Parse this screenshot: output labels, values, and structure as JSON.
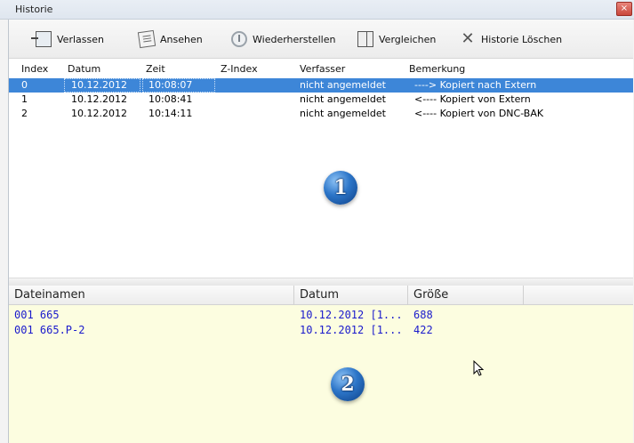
{
  "window": {
    "title": "Historie",
    "close_symbol": "×"
  },
  "toolbar": {
    "buttons": [
      {
        "label": "Verlassen",
        "icon": "exit-door-icon"
      },
      {
        "label": "Ansehen",
        "icon": "view-document-icon"
      },
      {
        "label": "Wiederherstellen",
        "icon": "restore-icon"
      },
      {
        "label": "Vergleichen",
        "icon": "compare-icon"
      },
      {
        "label": "Historie Löschen",
        "icon": "delete-x-icon"
      }
    ]
  },
  "history_table": {
    "columns": [
      "Index",
      "Datum",
      "Zeit",
      "Z-Index",
      "Verfasser",
      "Bemerkung"
    ],
    "rows": [
      {
        "index": "0",
        "datum": "10.12.2012",
        "zeit": "10:08:07",
        "z_index": "",
        "verfasser": "nicht angemeldet",
        "bemerkung": "----> Kopiert nach Extern",
        "selected": true
      },
      {
        "index": "1",
        "datum": "10.12.2012",
        "zeit": "10:08:41",
        "z_index": "",
        "verfasser": "nicht angemeldet",
        "bemerkung": "<---- Kopiert von Extern",
        "selected": false
      },
      {
        "index": "2",
        "datum": "10.12.2012",
        "zeit": "10:14:11",
        "z_index": "",
        "verfasser": "nicht angemeldet",
        "bemerkung": "<---- Kopiert von DNC-BAK",
        "selected": false
      }
    ]
  },
  "annotations": {
    "badge_1": "1",
    "badge_2": "2"
  },
  "files_table": {
    "columns": [
      "Dateinamen",
      "Datum",
      "Größe"
    ],
    "rows": [
      {
        "name": "001 665",
        "datum": "10.12.2012 [1...",
        "groesse": "688"
      },
      {
        "name": "001 665.P-2",
        "datum": "10.12.2012 [1...",
        "groesse": "422"
      }
    ]
  },
  "colors": {
    "selection": "#3d86d8",
    "file_text": "#1a1acc",
    "file_panel_bg": "#fcfde0",
    "badge": "#2c75c8"
  }
}
